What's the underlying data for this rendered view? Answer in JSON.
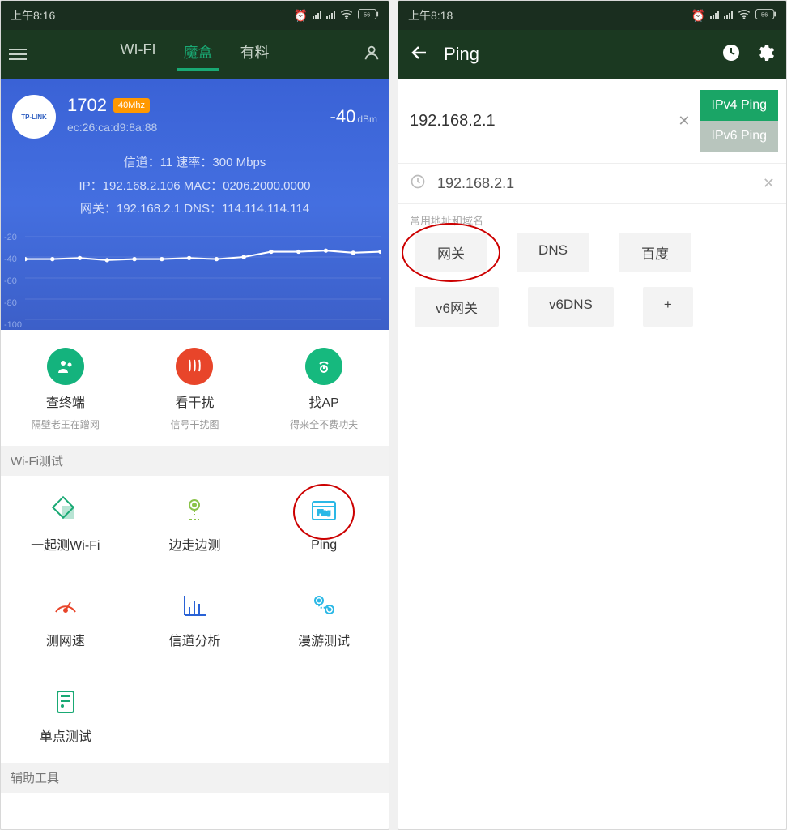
{
  "left": {
    "status_time": "上午8:16",
    "tabs": {
      "wifi": "WI-FI",
      "mohe": "魔盒",
      "youliao": "有料"
    },
    "hero": {
      "brand": "TP-LINK",
      "ssid": "1702",
      "badge": "40Mhz",
      "mac": "ec:26:ca:d9:8a:88",
      "rssi": "-40",
      "rssi_unit": "dBm",
      "line1": "信道：11  速率：300 Mbps",
      "line2": "IP：192.168.2.106  MAC：0206.2000.0000",
      "line3": "网关：192.168.2.1  DNS：114.114.114.114"
    },
    "chart_y": [
      "-20",
      "-40",
      "-60",
      "-80",
      "-100"
    ],
    "chart_data": {
      "type": "line",
      "ylabel": "dBm",
      "ylim": [
        -100,
        -20
      ],
      "values": [
        -42,
        -42,
        -41,
        -43,
        -42,
        -42,
        -41,
        -42,
        -40,
        -35,
        -35,
        -34,
        -36,
        -35
      ]
    },
    "tools": [
      {
        "label": "查终端",
        "sub": "隔壁老王在蹭网"
      },
      {
        "label": "看干扰",
        "sub": "信号干扰图"
      },
      {
        "label": "找AP",
        "sub": "得来全不费功夫"
      }
    ],
    "section_wifi": "Wi-Fi测试",
    "tests": [
      {
        "label": "一起测Wi-Fi"
      },
      {
        "label": "边走边测"
      },
      {
        "label": "Ping"
      },
      {
        "label": "测网速"
      },
      {
        "label": "信道分析"
      },
      {
        "label": "漫游测试"
      },
      {
        "label": "单点测试"
      }
    ],
    "section_aux": "辅助工具"
  },
  "right": {
    "status_time": "上午8:18",
    "title": "Ping",
    "input_value": "192.168.2.1",
    "ipv4_label": "IPv4 Ping",
    "ipv6_label": "IPv6 Ping",
    "history": "192.168.2.1",
    "hint": "常用地址和域名",
    "tags": [
      "网关",
      "DNS",
      "百度",
      "v6网关",
      "v6DNS",
      "+"
    ]
  }
}
